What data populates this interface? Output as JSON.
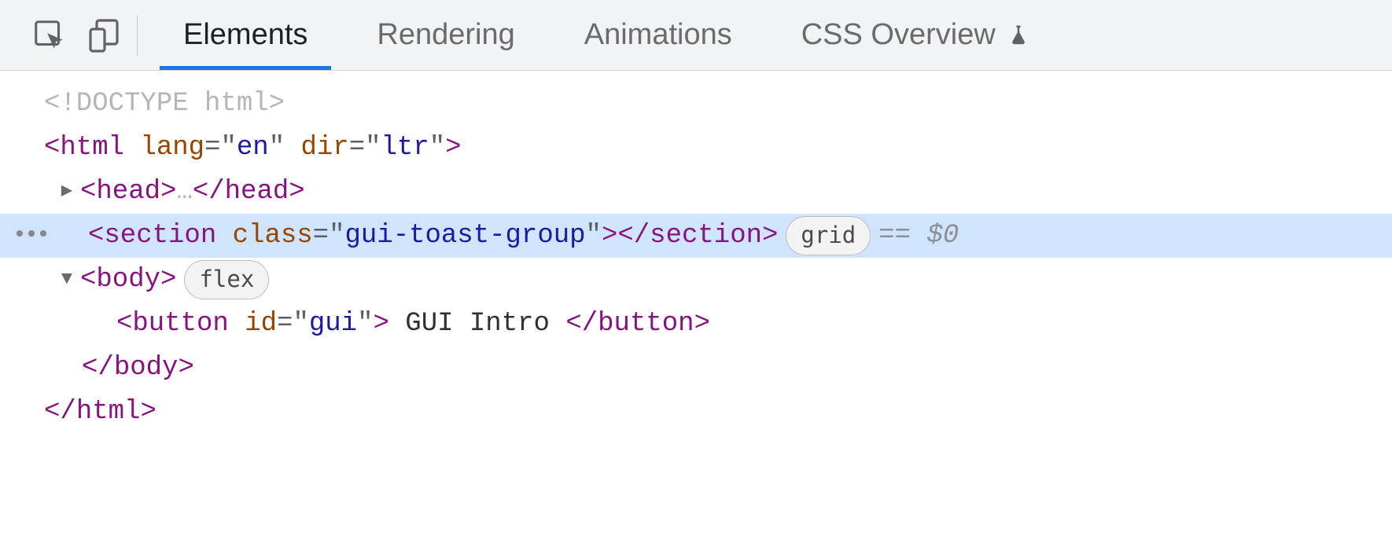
{
  "toolbar": {
    "tabs": [
      {
        "label": "Elements",
        "active": true
      },
      {
        "label": "Rendering",
        "active": false
      },
      {
        "label": "Animations",
        "active": false
      },
      {
        "label": "CSS Overview",
        "active": false,
        "experiment": true
      }
    ]
  },
  "dom": {
    "doctype": "<!DOCTYPE html>",
    "html_open": {
      "tag": "html",
      "attrs": [
        {
          "name": "lang",
          "value": "en"
        },
        {
          "name": "dir",
          "value": "ltr"
        }
      ]
    },
    "head": {
      "tag": "head",
      "ellipsis": "…"
    },
    "section": {
      "tag": "section",
      "attrs": [
        {
          "name": "class",
          "value": "gui-toast-group"
        }
      ],
      "layout_pill": "grid",
      "selected_suffix": "== $0"
    },
    "body_open": {
      "tag": "body",
      "layout_pill": "flex"
    },
    "button": {
      "tag": "button",
      "attrs": [
        {
          "name": "id",
          "value": "gui"
        }
      ],
      "text": " GUI Intro "
    },
    "body_close": {
      "tag": "body"
    },
    "html_close": {
      "tag": "html"
    },
    "gutter_icon": "•••"
  }
}
